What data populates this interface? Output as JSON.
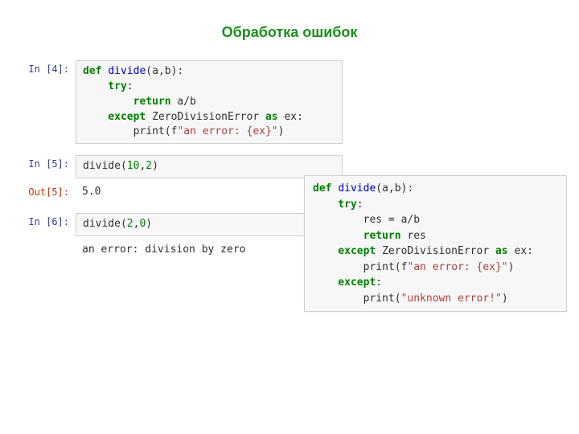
{
  "title": "Обработка ошибок",
  "cells": {
    "in4_prompt": "In [4]:",
    "in5_prompt": "In [5]:",
    "out5_prompt": "Out[5]:",
    "in6_prompt": "In [6]:",
    "in4": {
      "l1a": "def ",
      "l1b": "divide",
      "l1c": "(a,b):",
      "l2a": "    try",
      "l2b": ":",
      "l3a": "        return ",
      "l3b": "a/b",
      "l4a": "    except ",
      "l4b": "ZeroDivisionError ",
      "l4c": "as ",
      "l4d": "ex:",
      "l5a": "        print(f",
      "l5b": "\"an error: {ex}\"",
      "l5c": ")"
    },
    "in5": {
      "l1a": "divide(",
      "l1b": "10",
      "l1c": ",",
      "l1d": "2",
      "l1e": ")"
    },
    "out5": "5.0",
    "in6": {
      "l1a": "divide(",
      "l1b": "2",
      "l1c": ",",
      "l1d": "0",
      "l1e": ")"
    },
    "in6_out": "an error: division by zero"
  },
  "side": {
    "l1a": "def ",
    "l1b": "divide",
    "l1c": "(a,b):",
    "l2a": "    try",
    "l2b": ":",
    "l3": "        res = a/b",
    "l4a": "        return ",
    "l4b": "res",
    "l5a": "    except ",
    "l5b": "ZeroDivisionError ",
    "l5c": "as ",
    "l5d": "ex:",
    "l6a": "        print(f",
    "l6b": "\"an error: {ex}\"",
    "l6c": ")",
    "l7a": "    except",
    "l7b": ":",
    "l8a": "        print(",
    "l8b": "\"unknown error!\"",
    "l8c": ")"
  }
}
